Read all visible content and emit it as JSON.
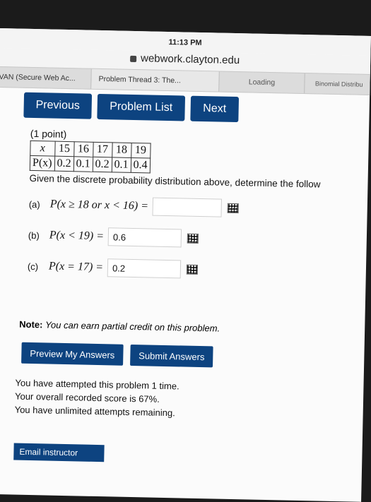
{
  "status_bar": {
    "time": "11:13 PM"
  },
  "url_bar": {
    "domain": "webwork.clayton.edu",
    "icon": "lock-icon"
  },
  "tabs": [
    {
      "label": "VAN (Secure Web Ac..."
    },
    {
      "label": "Problem Thread 3: The..."
    },
    {
      "label": "Loading"
    },
    {
      "label": "Binomial Distribu"
    }
  ],
  "nav": {
    "previous": "Previous",
    "problem_list": "Problem List",
    "next": "Next"
  },
  "problem": {
    "points": "(1 point)",
    "table": {
      "x_header": "x",
      "p_header": "P(x)",
      "x_values": [
        "15",
        "16",
        "17",
        "18",
        "19"
      ],
      "p_values": [
        "0.2",
        "0.1",
        "0.2",
        "0.1",
        "0.4"
      ]
    },
    "instructions": "Given the discrete probability distribution above, determine the follow",
    "parts": [
      {
        "label": "(a)",
        "expression": "P(x ≥ 18 or x < 16) =",
        "value": ""
      },
      {
        "label": "(b)",
        "expression": "P(x < 19) =",
        "value": "0.6"
      },
      {
        "label": "(c)",
        "expression": "P(x = 17) =",
        "value": "0.2"
      }
    ]
  },
  "note": {
    "prefix": "Note:",
    "text": "You can earn partial credit on this problem."
  },
  "buttons": {
    "preview": "Preview My Answers",
    "submit": "Submit Answers"
  },
  "attempts": {
    "line1": "You have attempted this problem 1 time.",
    "line2": "Your overall recorded score is 67%.",
    "line3": "You have unlimited attempts remaining."
  },
  "email_button": "Email instructor"
}
